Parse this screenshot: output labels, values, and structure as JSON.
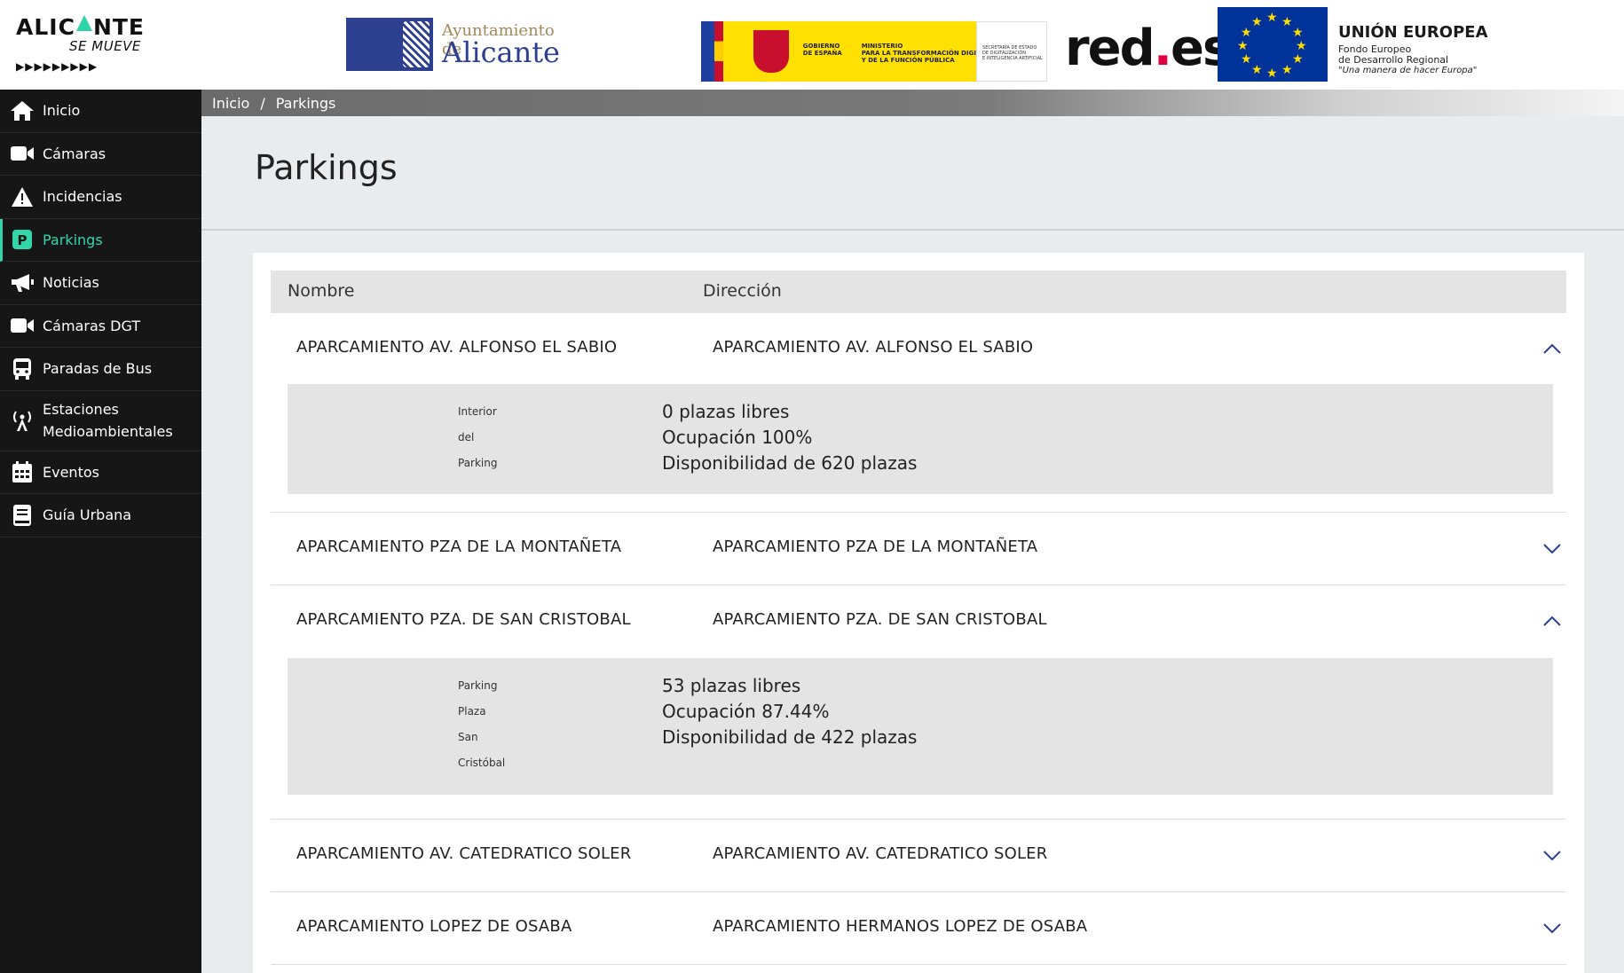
{
  "header": {
    "brand_main_1": "ALIC",
    "brand_main_2": "NTE",
    "brand_sub": "SE MUEVE",
    "brand_arrows": "▶▶▶▶▶▶▶▶▶",
    "ayto_line1": "Ayuntamiento de",
    "ayto_line2": "Alicante",
    "gob_text1": "GOBIERNO\nDE ESPAÑA",
    "gob_text2": "MINISTERIO\nPARA LA TRANSFORMACIÓN DIGITAL\nY DE LA FUNCIÓN PÚBLICA",
    "gob_text3": "SECRETARÍA DE ESTADO\nDE DIGITALIZACIÓN\nE INTELIGENCIA ARTIFICIAL",
    "redes_1": "red",
    "redes_dot": ".",
    "redes_2": "es",
    "eu_title": "UNIÓN EUROPEA",
    "eu_line1": "Fondo Europeo",
    "eu_line2": "de Desarrollo Regional",
    "eu_line3": "\"Una manera de hacer Europa\""
  },
  "colors": {
    "accent": "#33d6a8",
    "sidebar_bg": "#161616",
    "eu_blue": "#003399"
  },
  "sidebar": {
    "items": [
      {
        "label": "Inicio",
        "icon": "home-icon"
      },
      {
        "label": "Cámaras",
        "icon": "video-camera-icon"
      },
      {
        "label": "Incidencias",
        "icon": "warning-icon"
      },
      {
        "label": "Parkings",
        "icon": "parking-icon",
        "active": true
      },
      {
        "label": "Noticias",
        "icon": "megaphone-icon"
      },
      {
        "label": "Cámaras DGT",
        "icon": "video-camera-icon"
      },
      {
        "label": "Paradas de Bus",
        "icon": "bus-icon"
      },
      {
        "label_1": "Estaciones",
        "label_2": "Medioambientales",
        "icon": "antenna-icon"
      },
      {
        "label": "Eventos",
        "icon": "calendar-icon"
      },
      {
        "label": "Guía Urbana",
        "icon": "book-icon"
      }
    ]
  },
  "breadcrumb": {
    "home": "Inicio",
    "separator": "/",
    "current": "Parkings"
  },
  "page": {
    "title": "Parkings"
  },
  "table": {
    "col_name": "Nombre",
    "col_address": "Dirección",
    "rows": [
      {
        "name": "APARCAMIENTO AV. ALFONSO EL SABIO",
        "address": "APARCAMIENTO AV. ALFONSO EL SABIO",
        "expanded": true,
        "detail_label": [
          "Interior",
          "del",
          "Parking"
        ],
        "free": "0 plazas libres",
        "occupancy": "Ocupación 100%",
        "capacity": "Disponibilidad de 620 plazas"
      },
      {
        "name": "APARCAMIENTO PZA DE LA MONTAÑETA",
        "address": "APARCAMIENTO PZA DE LA MONTAÑETA",
        "expanded": false
      },
      {
        "name": "APARCAMIENTO PZA. DE SAN CRISTOBAL",
        "address": "APARCAMIENTO PZA. DE SAN CRISTOBAL",
        "expanded": true,
        "detail_label": [
          "Parking",
          "Plaza",
          "San",
          "Cristóbal"
        ],
        "free": "53 plazas libres",
        "occupancy": "Ocupación 87.44%",
        "capacity": "Disponibilidad de 422 plazas"
      },
      {
        "name": "APARCAMIENTO AV. CATEDRATICO SOLER",
        "address": "APARCAMIENTO AV. CATEDRATICO SOLER",
        "expanded": false
      },
      {
        "name": "APARCAMIENTO LOPEZ DE OSABA",
        "address": "APARCAMIENTO HERMANOS LOPEZ DE OSABA",
        "expanded": false
      }
    ]
  }
}
